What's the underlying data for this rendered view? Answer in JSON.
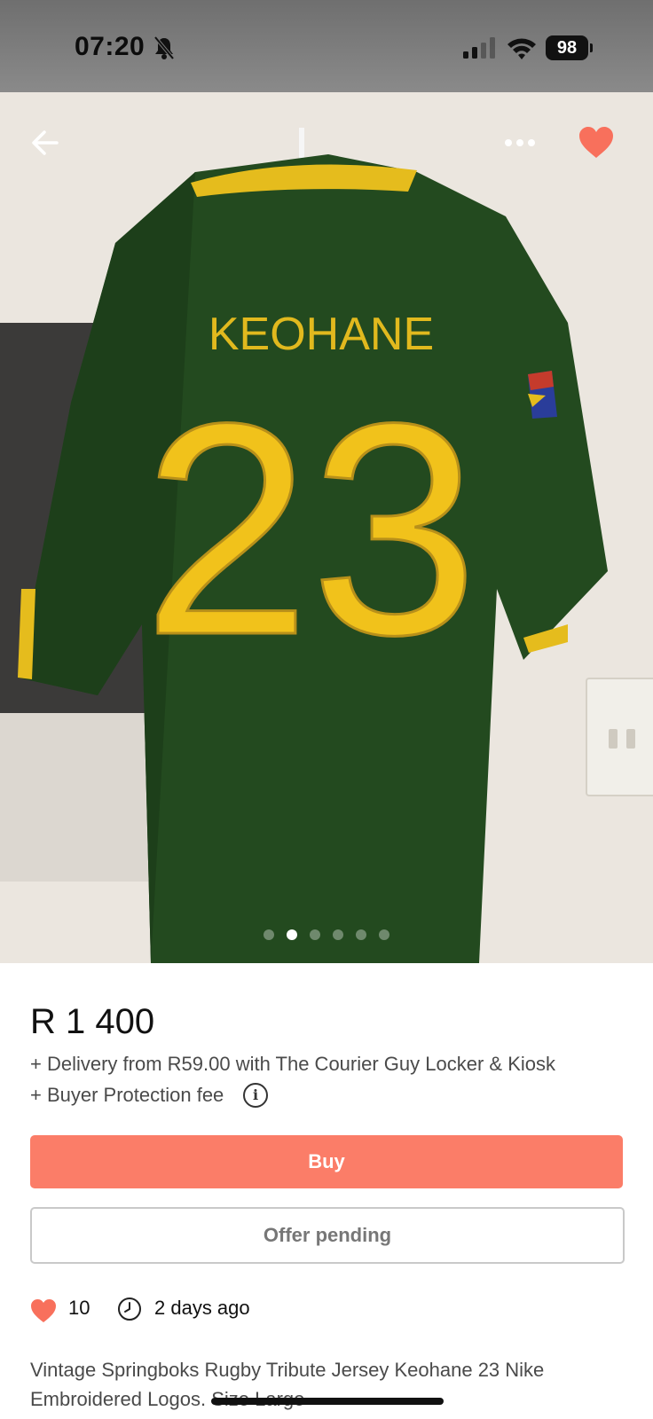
{
  "status_bar": {
    "time": "07:20",
    "battery": "98",
    "icons": [
      "bell-slash-icon",
      "signal-icon",
      "wifi-icon",
      "battery-icon"
    ]
  },
  "hero": {
    "image_description_name": "jersey-photo",
    "jersey_name": "KEOHANE",
    "jersey_number": "23",
    "carousel_count": 6,
    "carousel_active_index": 1,
    "top_icons": [
      "back-arrow-icon",
      "more-icon",
      "heart-icon"
    ]
  },
  "listing": {
    "price": "R 1 400",
    "delivery": "+ Delivery from R59.00 with The Courier Guy Locker & Kiosk",
    "protection": "+ Buyer Protection fee",
    "info_glyph": "i",
    "buy_label": "Buy",
    "offer_label": "Offer pending",
    "likes": "10",
    "posted": "2 days ago",
    "description": "Vintage Springboks Rugby Tribute Jersey  Keohane  23 Nike Embroidered Logos. Size Large"
  },
  "colors": {
    "accent": "#fb7d68",
    "heart": "#f8705c",
    "jersey_green": "#234a1f",
    "jersey_gold": "#f1c21b"
  }
}
